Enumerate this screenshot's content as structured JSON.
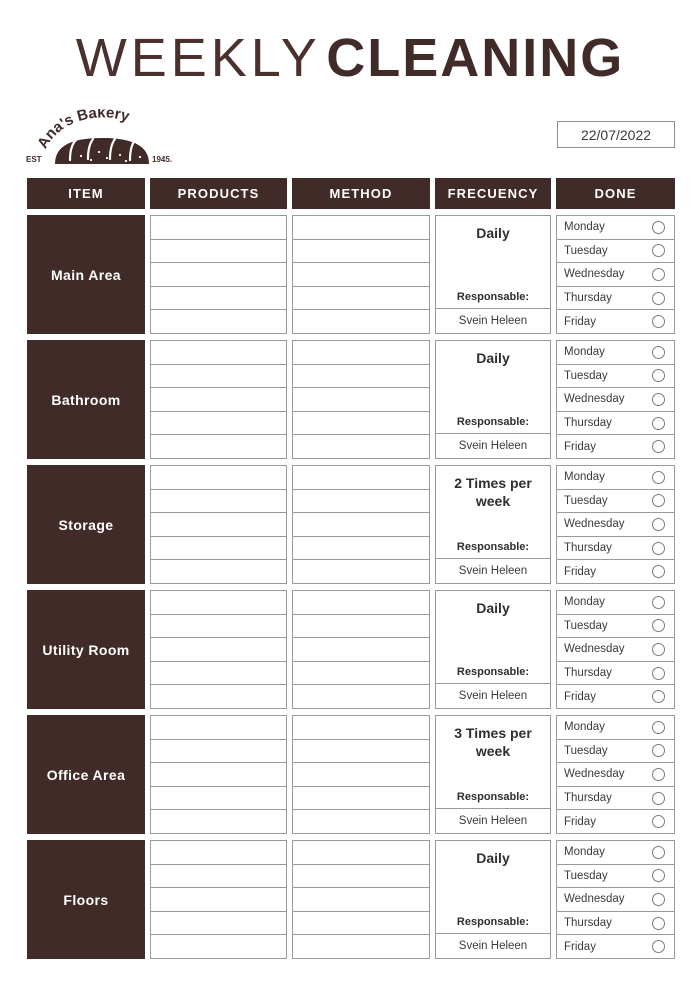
{
  "title": {
    "light": "WEEKLY",
    "bold": "CLEANING"
  },
  "logo": {
    "name": "Ana's Bakery",
    "est_label": "EST",
    "year": "1945."
  },
  "date": {
    "value": "22/07/2022"
  },
  "table": {
    "headers": [
      "ITEM",
      "PRODUCTS",
      "METHOD",
      "FRECUENCY",
      "DONE"
    ],
    "responsable_label": "Responsable:",
    "days": [
      "Monday",
      "Tuesday",
      "Wednesday",
      "Thursday",
      "Friday"
    ],
    "line_count": 5,
    "rows": [
      {
        "item": "Main Area",
        "frequency": "Daily",
        "responsable": "Svein Heleen"
      },
      {
        "item": "Bathroom",
        "frequency": "Daily",
        "responsable": "Svein Heleen"
      },
      {
        "item": "Storage",
        "frequency": "2 Times per week",
        "responsable": "Svein Heleen"
      },
      {
        "item": "Utility Room",
        "frequency": "Daily",
        "responsable": "Svein Heleen"
      },
      {
        "item": "Office Area",
        "frequency": "3 Times per week",
        "responsable": "Svein Heleen"
      },
      {
        "item": "Floors",
        "frequency": "Daily",
        "responsable": "Svein Heleen"
      }
    ]
  },
  "colors": {
    "brand_brown": "#402b28",
    "line_gray": "#9a9a9a",
    "text_gray": "#3b3b3b"
  }
}
